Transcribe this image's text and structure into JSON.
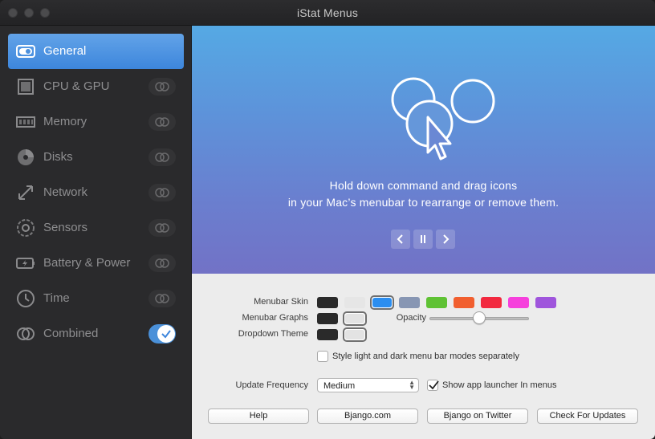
{
  "window": {
    "title": "iStat Menus"
  },
  "sidebar": {
    "items": [
      {
        "label": "General",
        "icon": "toggle-switch-icon",
        "selected": true
      },
      {
        "label": "CPU & GPU",
        "icon": "chip-icon"
      },
      {
        "label": "Memory",
        "icon": "memory-module-icon"
      },
      {
        "label": "Disks",
        "icon": "disk-icon"
      },
      {
        "label": "Network",
        "icon": "network-arrows-icon"
      },
      {
        "label": "Sensors",
        "icon": "fan-icon"
      },
      {
        "label": "Battery & Power",
        "icon": "battery-icon"
      },
      {
        "label": "Time",
        "icon": "clock-icon"
      },
      {
        "label": "Combined",
        "icon": "combined-circles-icon",
        "toggle_on": true
      }
    ]
  },
  "hero": {
    "line1": "Hold down command and drag icons",
    "line2": "in your Mac’s menubar to rearrange or remove them."
  },
  "settings": {
    "menubar_skin_label": "Menubar Skin",
    "menubar_graphs_label": "Menubar Graphs",
    "dropdown_theme_label": "Dropdown Theme",
    "opacity_label": "Opacity",
    "opacity_value": 0.5,
    "skin_colors": [
      "#2a2a2a",
      "#e6e6e6",
      "#2b8ef0",
      "#8796b3",
      "#5fc234",
      "#f15f2f",
      "#f2293f",
      "#f640dc",
      "#9f55dc"
    ],
    "skin_selected_index": 2,
    "graph_colors": [
      "#2a2a2a",
      "#e3e3e3"
    ],
    "graph_selected_index": 1,
    "theme_colors": [
      "#2a2a2a",
      "#e3e3e3"
    ],
    "theme_selected_index": 1,
    "separate_modes_label": "Style light and dark menu bar modes separately",
    "separate_modes_checked": false,
    "update_frequency_label": "Update Frequency",
    "update_frequency_value": "Medium",
    "show_launcher_label": "Show app launcher In menus",
    "show_launcher_checked": true
  },
  "buttons": {
    "help": "Help",
    "bjango": "Bjango.com",
    "twitter": "Bjango on Twitter",
    "updates": "Check For Updates"
  }
}
